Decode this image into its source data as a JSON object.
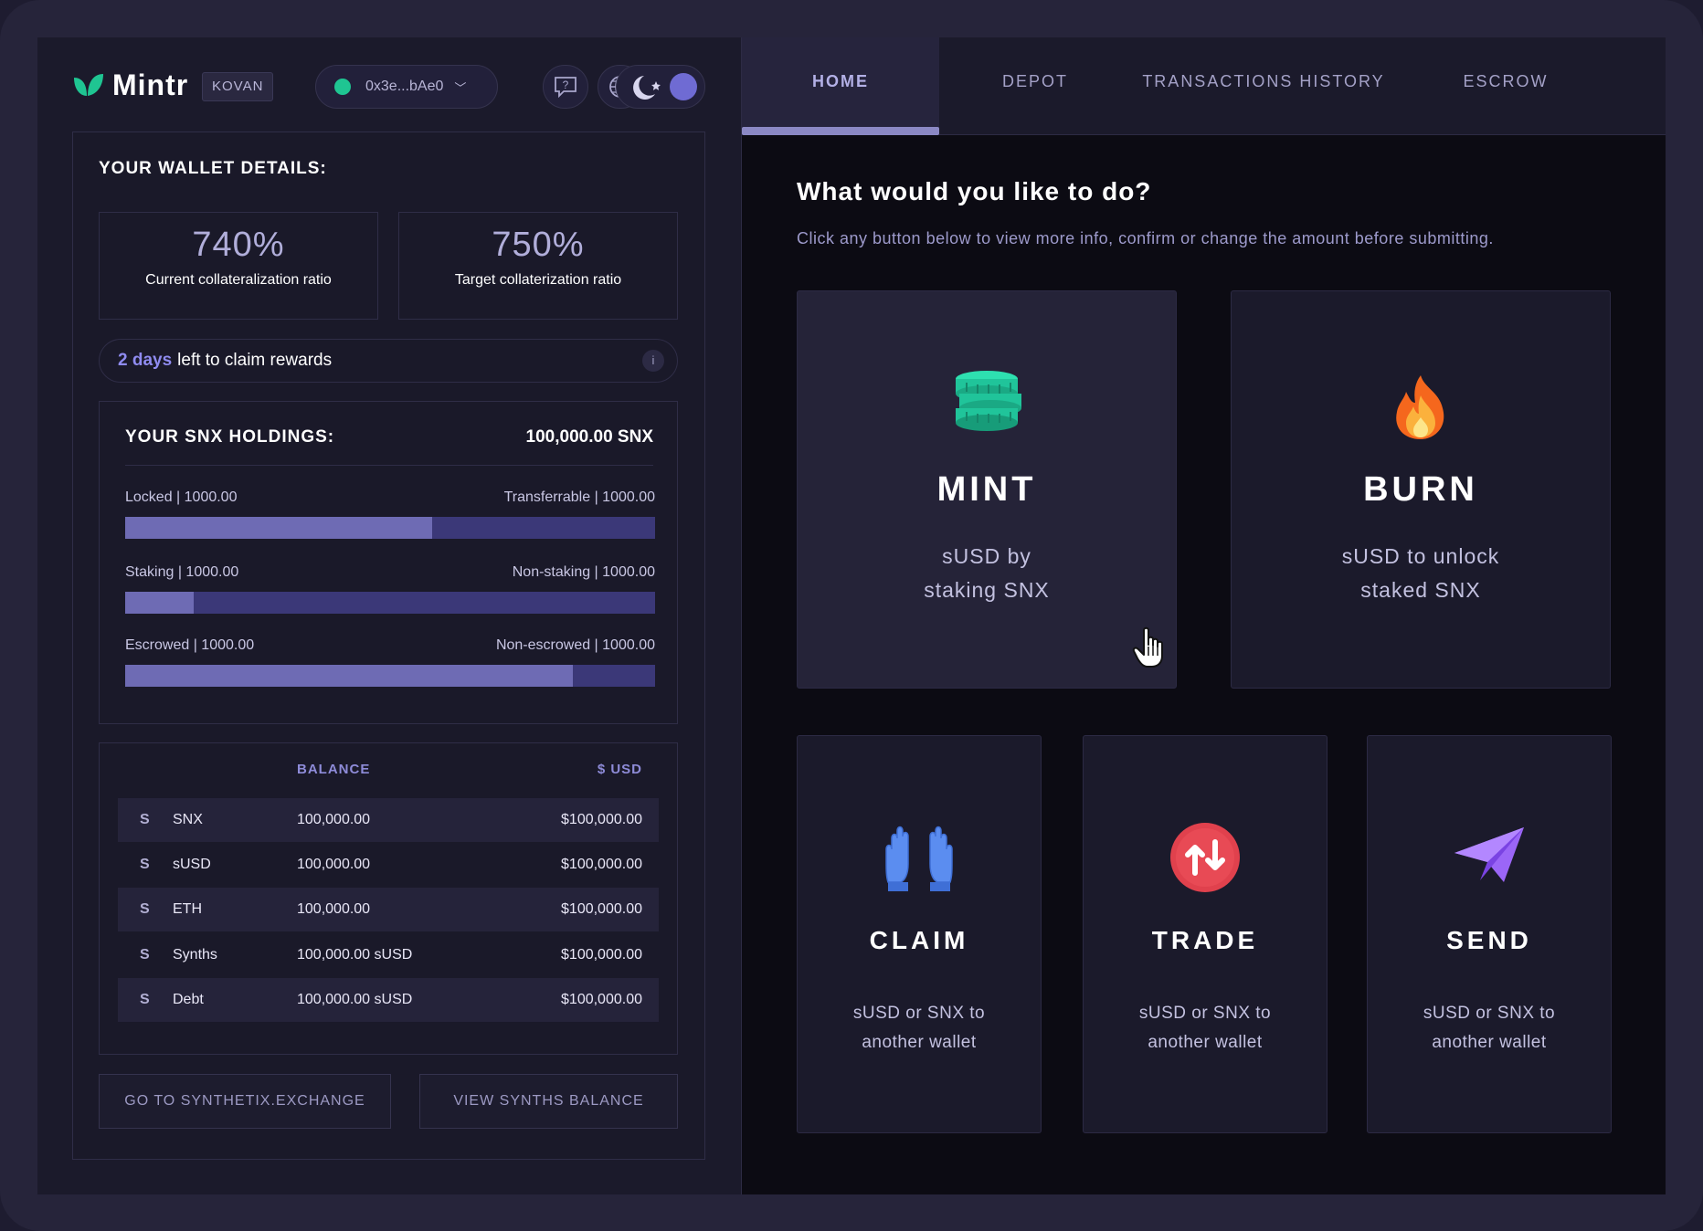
{
  "app": {
    "logo": "Mintr",
    "network": "KOVAN",
    "wallet_address": "0x3e...bAe0"
  },
  "tabs": [
    {
      "label": "HOME",
      "active": true
    },
    {
      "label": "DEPOT",
      "active": false
    },
    {
      "label": "TRANSACTIONS HISTORY",
      "active": false
    },
    {
      "label": "ESCROW",
      "active": false
    }
  ],
  "wallet": {
    "title": "YOUR WALLET DETAILS:",
    "current_ratio": "740%",
    "current_ratio_label": "Current collateralization ratio",
    "target_ratio": "750%",
    "target_ratio_label": "Target collaterization ratio",
    "rewards_days": "2 days",
    "rewards_text": "left to claim rewards",
    "rewards_info": "i"
  },
  "holdings": {
    "title": "YOUR SNX HOLDINGS:",
    "total": "100,000.00 SNX",
    "bars": [
      {
        "left": "Locked | 1000.00",
        "right": "Transferrable | 1000.00",
        "fill": 0.58
      },
      {
        "left": "Staking | 1000.00",
        "right": "Non-staking | 1000.00",
        "fill": 0.13
      },
      {
        "left": "Escrowed | 1000.00",
        "right": "Non-escrowed | 1000.00",
        "fill": 0.845
      }
    ]
  },
  "balances": {
    "col_balance": "BALANCE",
    "col_usd": "$ USD",
    "rows": [
      {
        "icon": "S",
        "name": "SNX",
        "balance": "100,000.00",
        "usd": "$100,000.00"
      },
      {
        "icon": "S",
        "name": "sUSD",
        "balance": "100,000.00",
        "usd": "$100,000.00"
      },
      {
        "icon": "S",
        "name": "ETH",
        "balance": "100,000.00",
        "usd": "$100,000.00"
      },
      {
        "icon": "S",
        "name": "Synths",
        "balance": "100,000.00 sUSD",
        "usd": "$100,000.00"
      },
      {
        "icon": "S",
        "name": "Debt",
        "balance": "100,000.00 sUSD",
        "usd": "$100,000.00"
      }
    ]
  },
  "buttons": {
    "exchange": "GO TO SYNTHETIX.EXCHANGE",
    "synths": "VIEW SYNTHS BALANCE"
  },
  "home": {
    "headline": "What would you like to do?",
    "subline": "Click any button below to view more info, confirm or change the amount before submitting.",
    "actions": [
      {
        "title": "MINT",
        "line1": "sUSD by",
        "line2": "staking SNX",
        "icon": "coins-icon"
      },
      {
        "title": "BURN",
        "line1": "sUSD to unlock",
        "line2": "staked SNX",
        "icon": "fire-icon"
      },
      {
        "title": "CLAIM",
        "line1": "sUSD or SNX to",
        "line2": "another wallet",
        "icon": "hands-icon"
      },
      {
        "title": "TRADE",
        "line1": "sUSD or SNX to",
        "line2": "another wallet",
        "icon": "swap-icon"
      },
      {
        "title": "SEND",
        "line1": "sUSD or SNX to",
        "line2": "another wallet",
        "icon": "paper-plane-icon"
      }
    ]
  },
  "colors": {
    "accent": "#8f8bf0",
    "wallet_status": "#1fc592",
    "mint_icon": "#20c49a",
    "trade_icon": "#e0414d",
    "send_icon": "#8a54f0",
    "claim_icon": "#5b8df0"
  }
}
